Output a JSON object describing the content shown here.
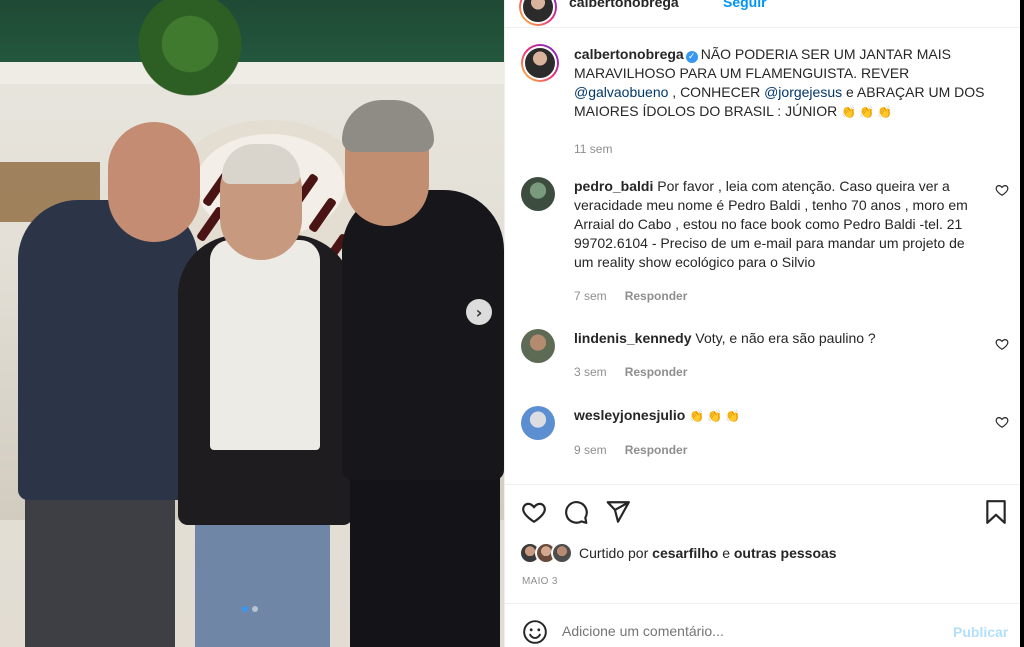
{
  "post": {
    "author": "calbertonobrega",
    "follow_label": "Seguir",
    "caption": {
      "username": "calbertonobrega",
      "text_part1": "NÃO PODERIA SER UM JANTAR MAIS MARAVILHOSO PARA UM FLAMENGUISTA. REVER ",
      "mention1": "@galvaobueno",
      "text_part2": " , CONHECER ",
      "mention2": "@jorgejesus",
      "text_part3": " e ABRAÇAR UM DOS MAIORES ÍDOLOS DO BRASIL : JÚNIOR ",
      "emoji": "👏👏👏",
      "time": "11 sem"
    },
    "comments": [
      {
        "username": "pedro_baldi",
        "text": "Por favor , leia com atenção. Caso queira ver a veracidade meu nome é Pedro Baldi , tenho 70 anos , moro em Arraial do Cabo , estou no face book como Pedro Baldi -tel. 21 99702.6104 - Preciso de um e-mail para mandar um projeto de um reality show ecológico para o Silvio",
        "time": "7 sem",
        "reply_label": "Responder"
      },
      {
        "username": "lindenis_kennedy",
        "text": "Voty, e não era são paulino ?",
        "time": "3 sem",
        "reply_label": "Responder"
      },
      {
        "username": "wesleyjonesjulio",
        "text": "👏👏👏",
        "time": "9 sem",
        "reply_label": "Responder"
      }
    ],
    "likes": {
      "prefix": "Curtido por",
      "user": "cesarfilho",
      "middle": "e",
      "others": "outras pessoas"
    },
    "date": "MAIO 3",
    "add_comment_placeholder": "Adicione um comentário...",
    "publish_label": "Publicar"
  },
  "icons": {
    "verified": "verified-badge-icon",
    "heart": "heart-icon",
    "comment": "comment-icon",
    "share": "paper-plane-icon",
    "save": "bookmark-icon",
    "emoji": "smiley-icon",
    "next": "chevron-right-icon"
  },
  "colors": {
    "link_blue": "#0095f6",
    "mention_blue": "#00376b",
    "muted_gray": "#8e8e8e",
    "publish_disabled": "#b2dffc"
  }
}
